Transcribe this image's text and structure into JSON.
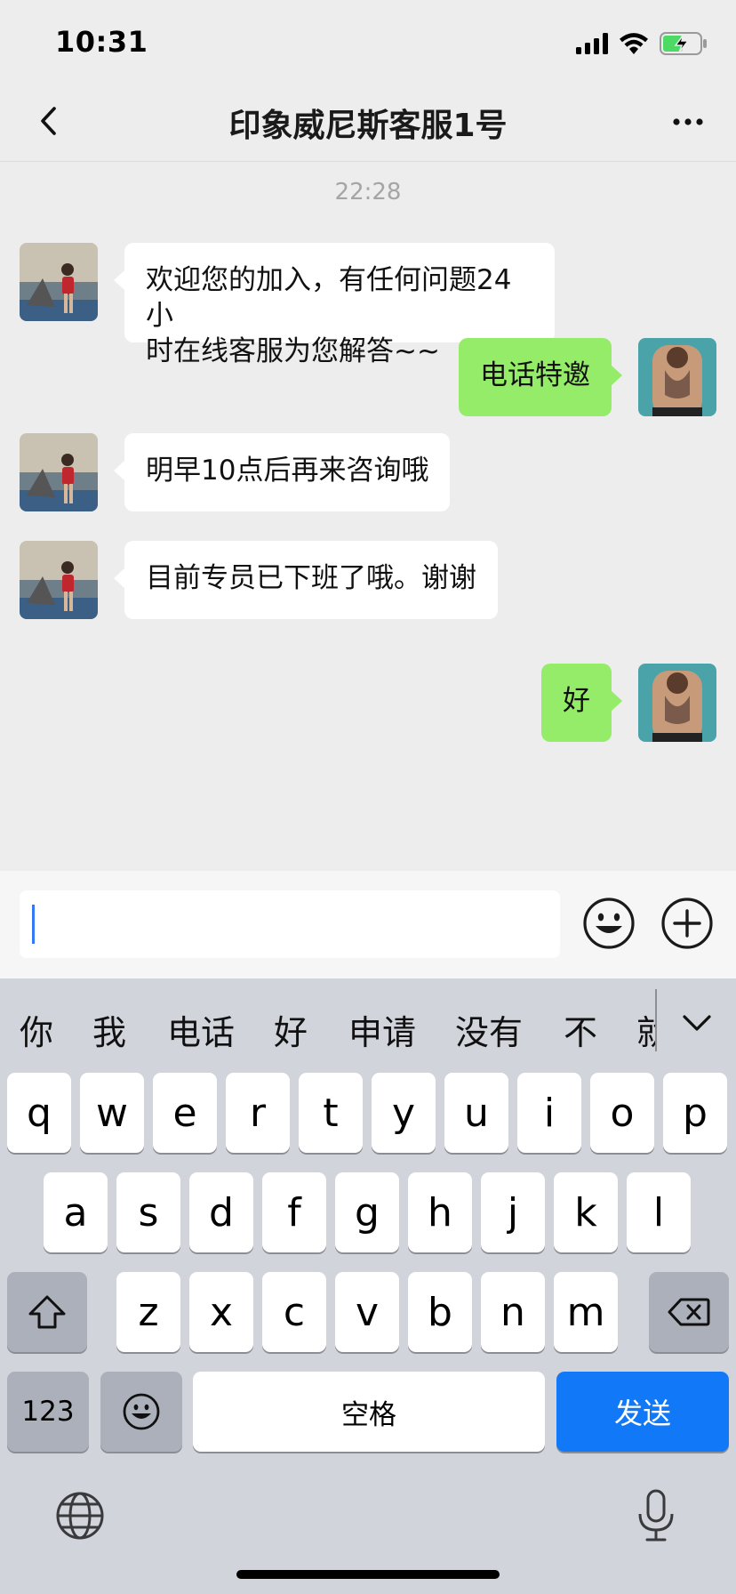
{
  "status_bar": {
    "time": "10:31"
  },
  "header": {
    "title": "印象威尼斯客服1号"
  },
  "chat": {
    "timestamp": "22:28",
    "messages": [
      {
        "side": "in",
        "text_lines": [
          "欢迎您的加入，有任何问题24小",
          "时在线客服为您解答~~"
        ]
      },
      {
        "side": "out",
        "text": "电话特邀"
      },
      {
        "side": "in",
        "text": "明早10点后再来咨询哦"
      },
      {
        "side": "in",
        "text": "目前专员已下班了哦。谢谢"
      },
      {
        "side": "out",
        "text": "好"
      }
    ]
  },
  "input": {
    "value": ""
  },
  "keyboard": {
    "candidates": [
      "你",
      "我",
      "电话",
      "好",
      "申请",
      "没有",
      "不",
      "就"
    ],
    "row1": [
      "q",
      "w",
      "e",
      "r",
      "t",
      "y",
      "u",
      "i",
      "o",
      "p"
    ],
    "row2": [
      "a",
      "s",
      "d",
      "f",
      "g",
      "h",
      "j",
      "k",
      "l"
    ],
    "row3": [
      "z",
      "x",
      "c",
      "v",
      "b",
      "n",
      "m"
    ],
    "numbers_label": "123",
    "space_label": "空格",
    "send_label": "发送"
  },
  "colors": {
    "outgoing_bubble": "#95ec69",
    "incoming_bubble": "#ffffff",
    "send_key": "#1178f7",
    "caret": "#3478f6"
  },
  "icons": [
    "back-icon",
    "more-icon",
    "emoji-icon",
    "plus-icon",
    "shift-icon",
    "delete-icon",
    "emoji-key-icon",
    "globe-icon",
    "mic-icon"
  ]
}
